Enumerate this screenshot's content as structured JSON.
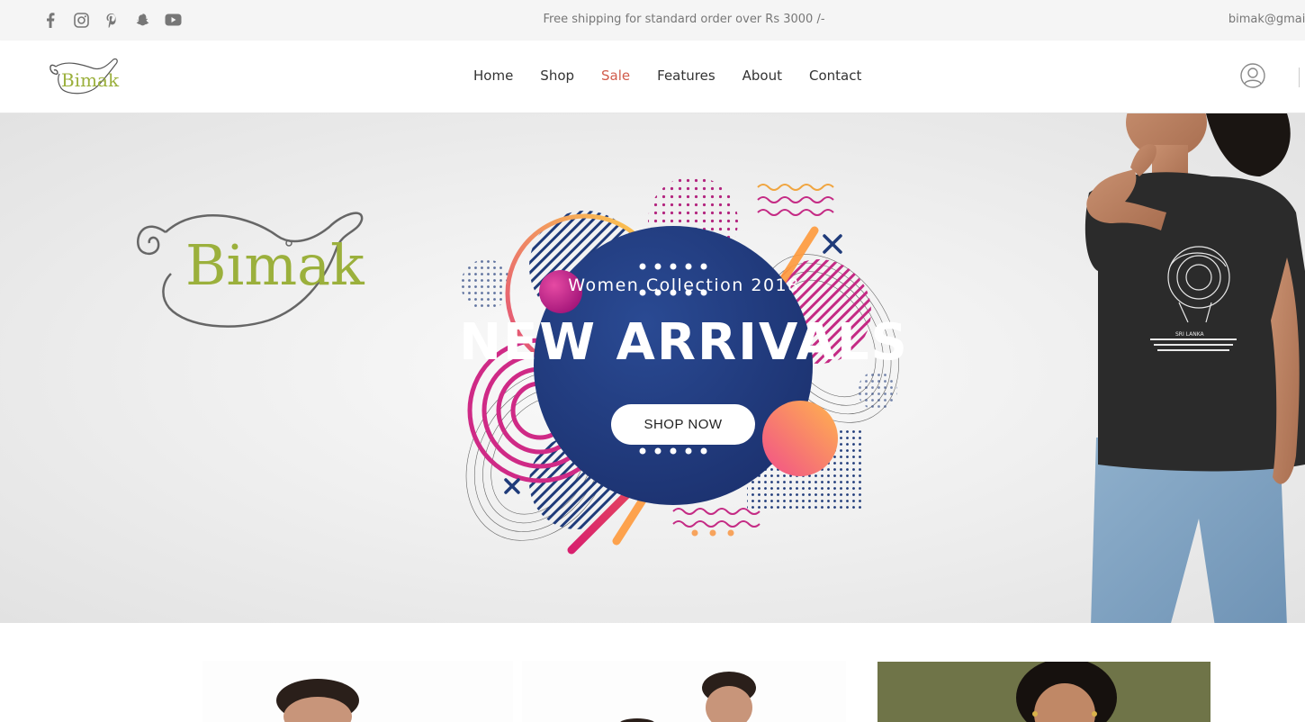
{
  "topbar": {
    "social_icons": [
      "facebook-icon",
      "instagram-icon",
      "pinterest-icon",
      "snapchat-icon",
      "youtube-icon"
    ],
    "shipping_text": "Free shipping for standard order over Rs 3000 /-",
    "email": "bimak@gmail"
  },
  "header": {
    "logo_text": "Bimak",
    "nav": [
      {
        "label": "Home"
      },
      {
        "label": "Shop"
      },
      {
        "label": "Sale"
      },
      {
        "label": "Features"
      },
      {
        "label": "About"
      },
      {
        "label": "Contact"
      }
    ],
    "user_icon": "user-icon"
  },
  "hero": {
    "logo_text": "Bimak",
    "subtitle": "Women Collection 2018",
    "title": "NEW ARRIVALS",
    "button_label": "SHOP NOW",
    "shirt_print_text": "SRI LANKA"
  },
  "colors": {
    "accent_sale": "#d15c4c",
    "logo_green": "#9bb03c",
    "hero_circle": "#1f3b7a",
    "magenta": "#d6267f",
    "orange": "#f7a35c"
  }
}
